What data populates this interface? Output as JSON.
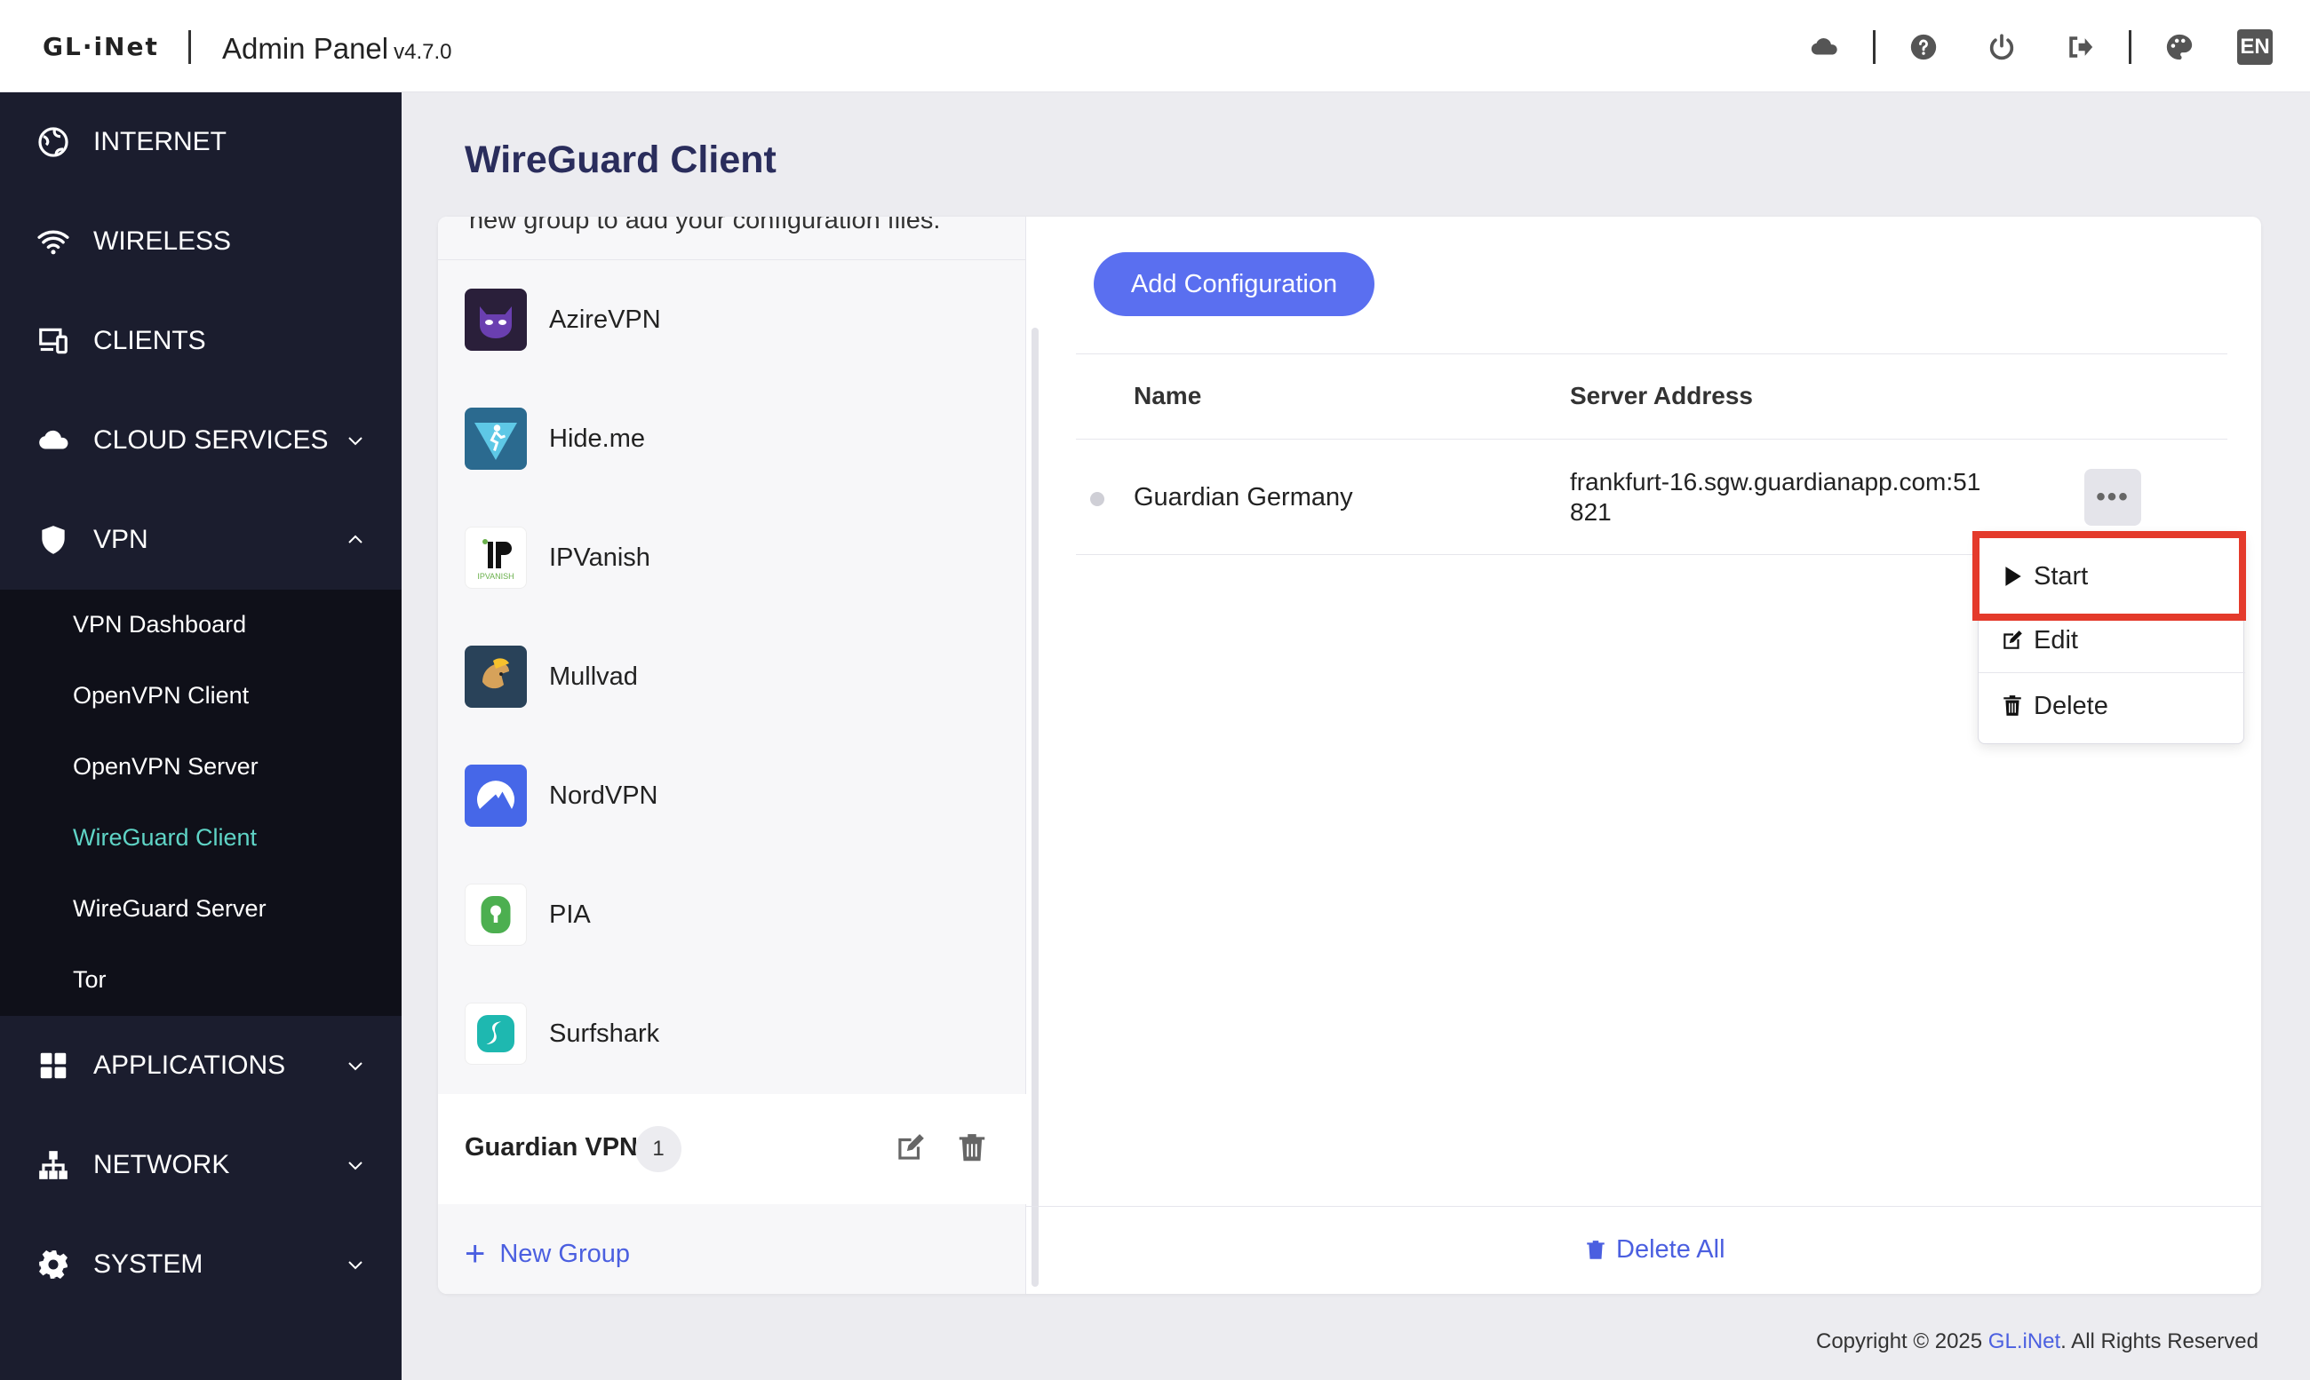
{
  "header": {
    "logo": "GL·iNet",
    "title": "Admin Panel",
    "version": "v4.7.0",
    "icons": [
      "cloud-icon",
      "help-icon",
      "power-icon",
      "logout-icon",
      "palette-icon"
    ],
    "language": "EN"
  },
  "sidebar": {
    "items": [
      {
        "label": "INTERNET",
        "icon": "globe-icon"
      },
      {
        "label": "WIRELESS",
        "icon": "wifi-icon"
      },
      {
        "label": "CLIENTS",
        "icon": "devices-icon"
      },
      {
        "label": "CLOUD SERVICES",
        "icon": "cloud-icon"
      },
      {
        "label": "VPN",
        "icon": "shield-icon"
      },
      {
        "label": "APPLICATIONS",
        "icon": "apps-icon"
      },
      {
        "label": "NETWORK",
        "icon": "network-icon"
      },
      {
        "label": "SYSTEM",
        "icon": "gear-icon"
      }
    ],
    "vpn_submenu": [
      {
        "label": "VPN Dashboard"
      },
      {
        "label": "OpenVPN Client"
      },
      {
        "label": "OpenVPN Server"
      },
      {
        "label": "WireGuard Client"
      },
      {
        "label": "WireGuard Server"
      },
      {
        "label": "Tor"
      }
    ]
  },
  "main": {
    "heading": "WireGuard Client",
    "cut_text": "new group to add your configuration files.",
    "providers": [
      {
        "name": "AzireVPN",
        "color": "#2a1f3a"
      },
      {
        "name": "Hide.me",
        "color": "#2b6a8f"
      },
      {
        "name": "IPVanish",
        "color": "#ffffff"
      },
      {
        "name": "Mullvad",
        "color": "#294259"
      },
      {
        "name": "NordVPN",
        "color": "#4667e8"
      },
      {
        "name": "PIA",
        "color": "#ffffff"
      },
      {
        "name": "Surfshark",
        "color": "#ffffff"
      }
    ],
    "group": {
      "name": "Guardian VPN",
      "count": "1"
    },
    "new_group_label": "New Group",
    "add_config_label": "Add Configuration",
    "table": {
      "headers": [
        "Name",
        "Server Address"
      ],
      "rows": [
        {
          "name": "Guardian Germany",
          "address": "frankfurt-16.sgw.guardianapp.com:51821"
        }
      ]
    },
    "more_label": "•••",
    "dropdown": [
      {
        "label": "Start",
        "icon": "play-icon"
      },
      {
        "label": "Edit",
        "icon": "edit-icon"
      },
      {
        "label": "Delete",
        "icon": "trash-icon"
      }
    ],
    "delete_all_label": "Delete All"
  },
  "footer": {
    "prefix": "Copyright © 2025 ",
    "link": "GL.iNet",
    "suffix": ". All Rights Reserved"
  }
}
